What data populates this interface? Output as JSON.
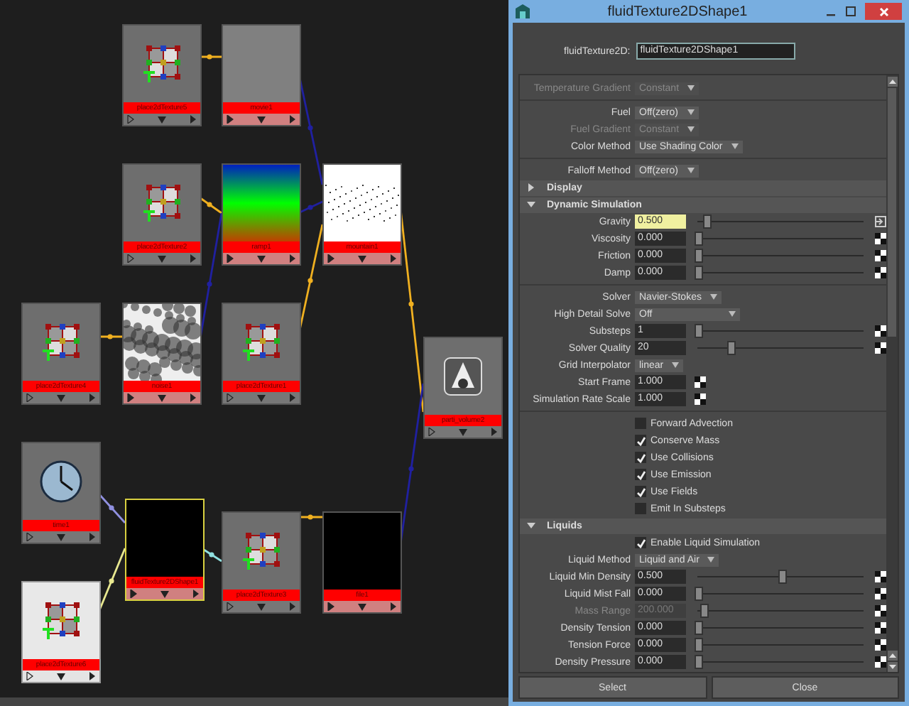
{
  "node_graph": {
    "nodes": [
      {
        "label": "place2dTexture5",
        "kind": "place2d",
        "selected": false,
        "highlighted": false
      },
      {
        "label": "movie1",
        "kind": "movie",
        "selected": false,
        "highlighted": false
      },
      {
        "label": "place2dTexture2",
        "kind": "place2d",
        "selected": false,
        "highlighted": false
      },
      {
        "label": "ramp1",
        "kind": "ramp",
        "selected": false,
        "highlighted": false
      },
      {
        "label": "mountain1",
        "kind": "mountain",
        "selected": false,
        "highlighted": false
      },
      {
        "label": "place2dTexture4",
        "kind": "place2d",
        "selected": false,
        "highlighted": false
      },
      {
        "label": "noise1",
        "kind": "noise",
        "selected": false,
        "highlighted": false
      },
      {
        "label": "place2dTexture1",
        "kind": "place2d",
        "selected": false,
        "highlighted": false
      },
      {
        "label": "parti_volume2",
        "kind": "volume",
        "selected": false,
        "highlighted": false
      },
      {
        "label": "time1",
        "kind": "time",
        "selected": false,
        "highlighted": false
      },
      {
        "label": "fluidTexture2DShape1",
        "kind": "black",
        "selected": true,
        "highlighted": false
      },
      {
        "label": "place2dTexture3",
        "kind": "place2d",
        "selected": false,
        "highlighted": false
      },
      {
        "label": "file1",
        "kind": "black",
        "selected": false,
        "highlighted": false
      },
      {
        "label": "place2dTexture6",
        "kind": "place2d",
        "selected": false,
        "highlighted": true
      }
    ]
  },
  "attribute_editor": {
    "title": "fluidTexture2DShape1",
    "name_label": "fluidTexture2D:",
    "name_value": "fluidTexture2DShape1",
    "rows": [
      {
        "kind": "dropdown",
        "label": "Temperature Gradient",
        "value": "Constant",
        "disabled": true
      },
      {
        "kind": "divider"
      },
      {
        "kind": "dropdown",
        "label": "Fuel",
        "value": "Off(zero)",
        "disabled": false
      },
      {
        "kind": "dropdown",
        "label": "Fuel Gradient",
        "value": "Constant",
        "disabled": true
      },
      {
        "kind": "dropdown",
        "label": "Color Method",
        "value": "Use Shading Color",
        "disabled": false
      },
      {
        "kind": "divider"
      },
      {
        "kind": "dropdown",
        "label": "Falloff Method",
        "value": "Off(zero)",
        "disabled": false
      },
      {
        "kind": "section",
        "label": "Display",
        "expanded": false
      },
      {
        "kind": "section",
        "label": "Dynamic Simulation",
        "expanded": true
      },
      {
        "kind": "slider",
        "label": "Gravity",
        "value": "0.500",
        "level": 0.05,
        "keyed": true,
        "disabled": false
      },
      {
        "kind": "slider",
        "label": "Viscosity",
        "value": "0.000",
        "level": 0,
        "keyed": false,
        "disabled": false
      },
      {
        "kind": "slider",
        "label": "Friction",
        "value": "0.000",
        "level": 0,
        "keyed": false,
        "disabled": false
      },
      {
        "kind": "slider",
        "label": "Damp",
        "value": "0.000",
        "level": 0,
        "keyed": false,
        "disabled": false
      },
      {
        "kind": "divider"
      },
      {
        "kind": "dropdown",
        "label": "Solver",
        "value": "Navier-Stokes",
        "disabled": false
      },
      {
        "kind": "dropdown",
        "label": "High Detail Solve",
        "value": "Off",
        "disabled": false
      },
      {
        "kind": "slider",
        "label": "Substeps",
        "value": "1",
        "level": 0,
        "keyed": false,
        "disabled": false
      },
      {
        "kind": "slider",
        "label": "Solver Quality",
        "value": "20",
        "level": 0.2,
        "keyed": false,
        "disabled": false
      },
      {
        "kind": "dropdown",
        "label": "Grid Interpolator",
        "value": "linear",
        "disabled": false
      },
      {
        "kind": "field",
        "label": "Start Frame",
        "value": "1.000"
      },
      {
        "kind": "field",
        "label": "Simulation Rate Scale",
        "value": "1.000"
      },
      {
        "kind": "divider"
      },
      {
        "kind": "checkbox",
        "label": "Forward Advection",
        "checked": false
      },
      {
        "kind": "checkbox",
        "label": "Conserve Mass",
        "checked": true
      },
      {
        "kind": "checkbox",
        "label": "Use Collisions",
        "checked": true
      },
      {
        "kind": "checkbox",
        "label": "Use Emission",
        "checked": true
      },
      {
        "kind": "checkbox",
        "label": "Use Fields",
        "checked": true
      },
      {
        "kind": "checkbox",
        "label": "Emit In Substeps",
        "checked": false
      },
      {
        "kind": "section",
        "label": "Liquids",
        "expanded": true
      },
      {
        "kind": "checkbox",
        "label": "Enable Liquid Simulation",
        "checked": true
      },
      {
        "kind": "dropdown",
        "label": "Liquid Method",
        "value": "Liquid and Air",
        "disabled": false
      },
      {
        "kind": "slider",
        "label": "Liquid Min Density",
        "value": "0.500",
        "level": 0.5,
        "keyed": false,
        "disabled": false
      },
      {
        "kind": "slider",
        "label": "Liquid Mist Fall",
        "value": "0.000",
        "level": 0,
        "keyed": false,
        "disabled": false
      },
      {
        "kind": "slider",
        "label": "Mass Range",
        "value": "200.000",
        "level": 0.03,
        "keyed": false,
        "disabled": true
      },
      {
        "kind": "slider",
        "label": "Density Tension",
        "value": "0.000",
        "level": 0,
        "keyed": false,
        "disabled": false
      },
      {
        "kind": "slider",
        "label": "Tension Force",
        "value": "0.000",
        "level": 0,
        "keyed": false,
        "disabled": false
      },
      {
        "kind": "slider",
        "label": "Density Pressure",
        "value": "0.000",
        "level": 0,
        "keyed": false,
        "disabled": false
      }
    ],
    "buttons": [
      "Select",
      "Close"
    ]
  }
}
